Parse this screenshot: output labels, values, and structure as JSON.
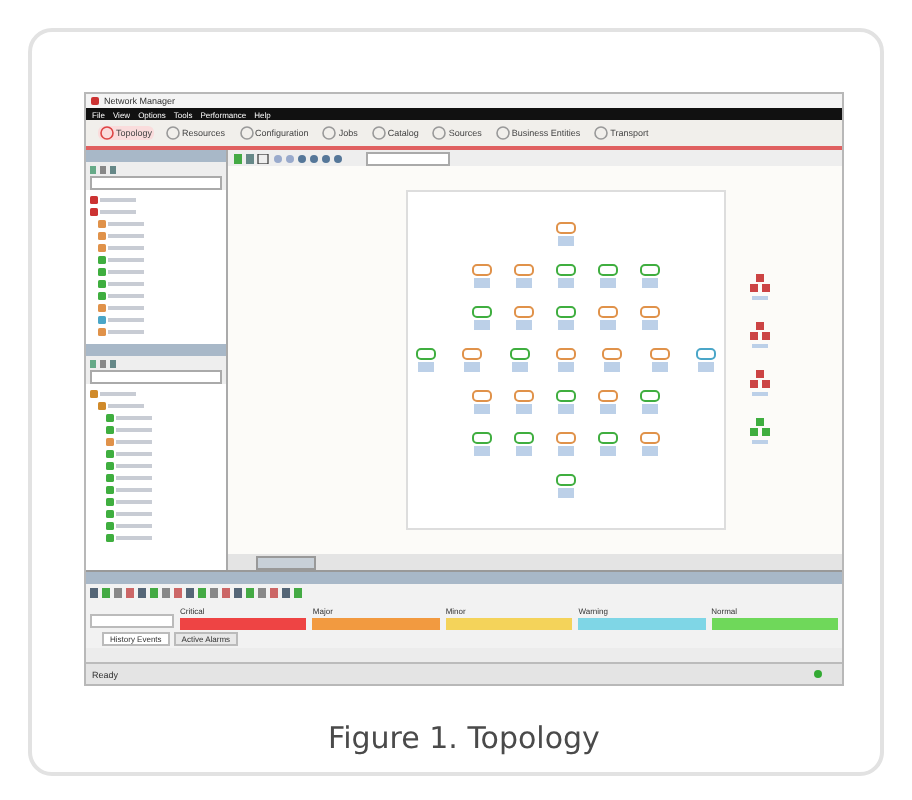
{
  "app": {
    "title": "Network Manager",
    "menu": [
      "File",
      "View",
      "Options",
      "Tools",
      "Performance",
      "Help"
    ],
    "tabs": [
      {
        "label": "Topology",
        "selected": true
      },
      {
        "label": "Resources",
        "selected": false
      },
      {
        "label": "Configuration",
        "selected": false
      },
      {
        "label": "Jobs",
        "selected": false
      },
      {
        "label": "Catalog",
        "selected": false
      },
      {
        "label": "Sources",
        "selected": false
      },
      {
        "label": "Business Entities",
        "selected": false
      },
      {
        "label": "Transport",
        "selected": false
      }
    ],
    "tree_top": [
      {
        "color": "#cc3333"
      },
      {
        "color": "#cc3333",
        "children": [
          {
            "color": "#e0924a"
          },
          {
            "color": "#e0924a"
          },
          {
            "color": "#e0924a"
          },
          {
            "color": "#3fae3f"
          },
          {
            "color": "#3fae3f"
          },
          {
            "color": "#3fae3f"
          },
          {
            "color": "#3fae3f"
          },
          {
            "color": "#e0924a"
          },
          {
            "color": "#4aa6c8"
          },
          {
            "color": "#e0924a"
          }
        ]
      }
    ],
    "tree_bottom": [
      {
        "color": "#d08a2a",
        "children": [
          {
            "color": "#d08a2a",
            "children": [
              {
                "color": "#3fae3f"
              },
              {
                "color": "#3fae3f"
              },
              {
                "color": "#e0924a"
              },
              {
                "color": "#3fae3f"
              },
              {
                "color": "#3fae3f"
              },
              {
                "color": "#3fae3f"
              },
              {
                "color": "#3fae3f"
              },
              {
                "color": "#3fae3f"
              },
              {
                "color": "#3fae3f"
              },
              {
                "color": "#3fae3f"
              },
              {
                "color": "#3fae3f"
              }
            ]
          }
        ]
      }
    ],
    "topology": {
      "rows": [
        [
          {
            "color": "#e0924a"
          }
        ],
        [
          {
            "color": "#e0924a"
          },
          {
            "color": "#e0924a"
          },
          {
            "color": "#3fae3f"
          },
          {
            "color": "#3fae3f"
          },
          {
            "color": "#3fae3f"
          }
        ],
        [
          {
            "color": "#3fae3f"
          },
          {
            "color": "#e0924a"
          },
          {
            "color": "#3fae3f"
          },
          {
            "color": "#e0924a"
          },
          {
            "color": "#e0924a"
          }
        ],
        [
          {
            "color": "#3fae3f"
          },
          {
            "color": "#e0924a"
          },
          {
            "color": "#3fae3f"
          },
          {
            "color": "#e0924a"
          },
          {
            "color": "#e0924a"
          },
          {
            "color": "#e0924a"
          },
          {
            "color": "#4aa6c8"
          }
        ],
        [
          {
            "color": "#e0924a"
          },
          {
            "color": "#e0924a"
          },
          {
            "color": "#3fae3f"
          },
          {
            "color": "#e0924a"
          },
          {
            "color": "#3fae3f"
          }
        ],
        [
          {
            "color": "#3fae3f"
          },
          {
            "color": "#3fae3f"
          },
          {
            "color": "#e0924a"
          },
          {
            "color": "#3fae3f"
          },
          {
            "color": "#e0924a"
          }
        ],
        [
          {
            "color": "#3fae3f"
          }
        ]
      ],
      "side": [
        {
          "color": "#cc4444"
        },
        {
          "color": "#cc4444"
        },
        {
          "color": "#cc4444"
        },
        {
          "color": "#3fae3f"
        }
      ]
    },
    "severity": [
      {
        "label": "Critical",
        "color": "#ee4444"
      },
      {
        "label": "Major",
        "color": "#f29a40"
      },
      {
        "label": "Minor",
        "color": "#f4d35a"
      },
      {
        "label": "Warning",
        "color": "#7fd6e6"
      },
      {
        "label": "Normal",
        "color": "#6fd85a"
      }
    ],
    "event_tabs": [
      {
        "label": "History Events",
        "selected": true
      },
      {
        "label": "Active Alarms",
        "selected": false
      }
    ],
    "status": "Ready"
  },
  "caption": "Figure 1.  Topology"
}
